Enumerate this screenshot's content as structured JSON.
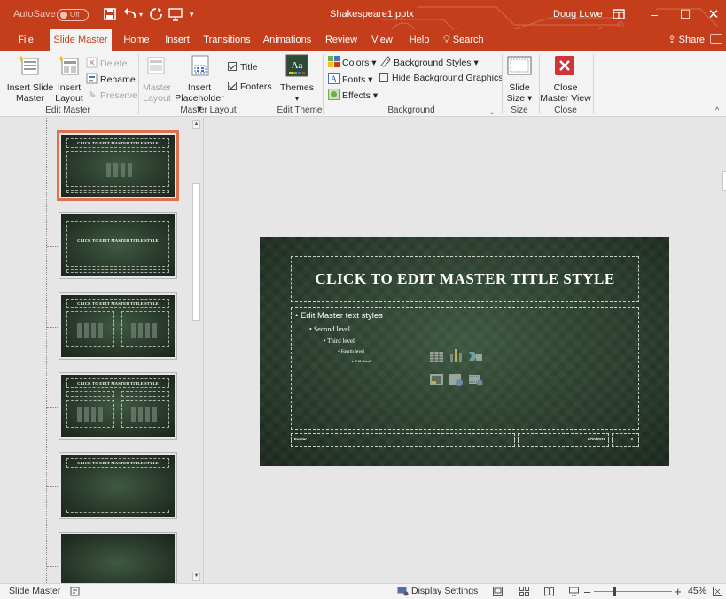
{
  "titlebar": {
    "autosave_label": "AutoSave",
    "autosave_state": "Off",
    "doc_title": "Shakespeare1.pptx",
    "user_name": "Doug Lowe"
  },
  "tabs": [
    {
      "label": "File"
    },
    {
      "label": "Slide Master"
    },
    {
      "label": "Home"
    },
    {
      "label": "Insert"
    },
    {
      "label": "Transitions"
    },
    {
      "label": "Animations"
    },
    {
      "label": "Review"
    },
    {
      "label": "View"
    },
    {
      "label": "Help"
    },
    {
      "label": "Search"
    }
  ],
  "share_label": "Share",
  "ribbon": {
    "edit_master": {
      "insert_slide_master": [
        "Insert Slide",
        "Master"
      ],
      "insert_layout": [
        "Insert",
        "Layout"
      ],
      "delete": "Delete",
      "rename": "Rename",
      "preserve": "Preserve",
      "group": "Edit Master"
    },
    "master_layout": {
      "master_layout_btn": [
        "Master",
        "Layout"
      ],
      "insert_placeholder": [
        "Insert",
        "Placeholder"
      ],
      "title": "Title",
      "footers": "Footers",
      "group": "Master Layout"
    },
    "edit_theme": {
      "themes": "Themes",
      "group": "Edit Theme"
    },
    "background": {
      "colors": "Colors",
      "fonts": "Fonts",
      "effects": "Effects",
      "background_styles": "Background Styles",
      "hide_bg_graphics": "Hide Background Graphics",
      "group": "Background"
    },
    "size": {
      "slide_size": [
        "Slide",
        "Size"
      ],
      "group": "Size"
    },
    "close": {
      "close_master_view": [
        "Close",
        "Master View"
      ],
      "group": "Close"
    }
  },
  "thumbnails": [
    {
      "title": "CLICK TO EDIT MASTER TITLE STYLE",
      "selected": true
    },
    {
      "title": "CLICK TO EDIT MASTER TITLE STYLE",
      "selected": false
    },
    {
      "title": "CLICK TO EDIT MASTER TITLE STYLE",
      "selected": false
    },
    {
      "title": "CLICK TO EDIT MASTER TITLE STYLE",
      "selected": false
    },
    {
      "title": "CLICK TO EDIT MASTER TITLE STYLE",
      "selected": false
    },
    {
      "title": "",
      "selected": false
    }
  ],
  "slide": {
    "title": "CLICK TO EDIT MASTER TITLE STYLE",
    "levels": [
      "Edit Master text styles",
      "Second level",
      "Third level",
      "Fourth level",
      "Fifth level"
    ],
    "footer": "Footer",
    "date": "9/20/2018",
    "number": "#"
  },
  "statusbar": {
    "view_name": "Slide Master",
    "display_settings": "Display Settings",
    "zoom": "45%"
  },
  "colors": {
    "accent": "#c43e1c",
    "ribbon_bg": "#f3f3f3",
    "selected_thumb": "#e07150",
    "close_red": "#d13438"
  }
}
